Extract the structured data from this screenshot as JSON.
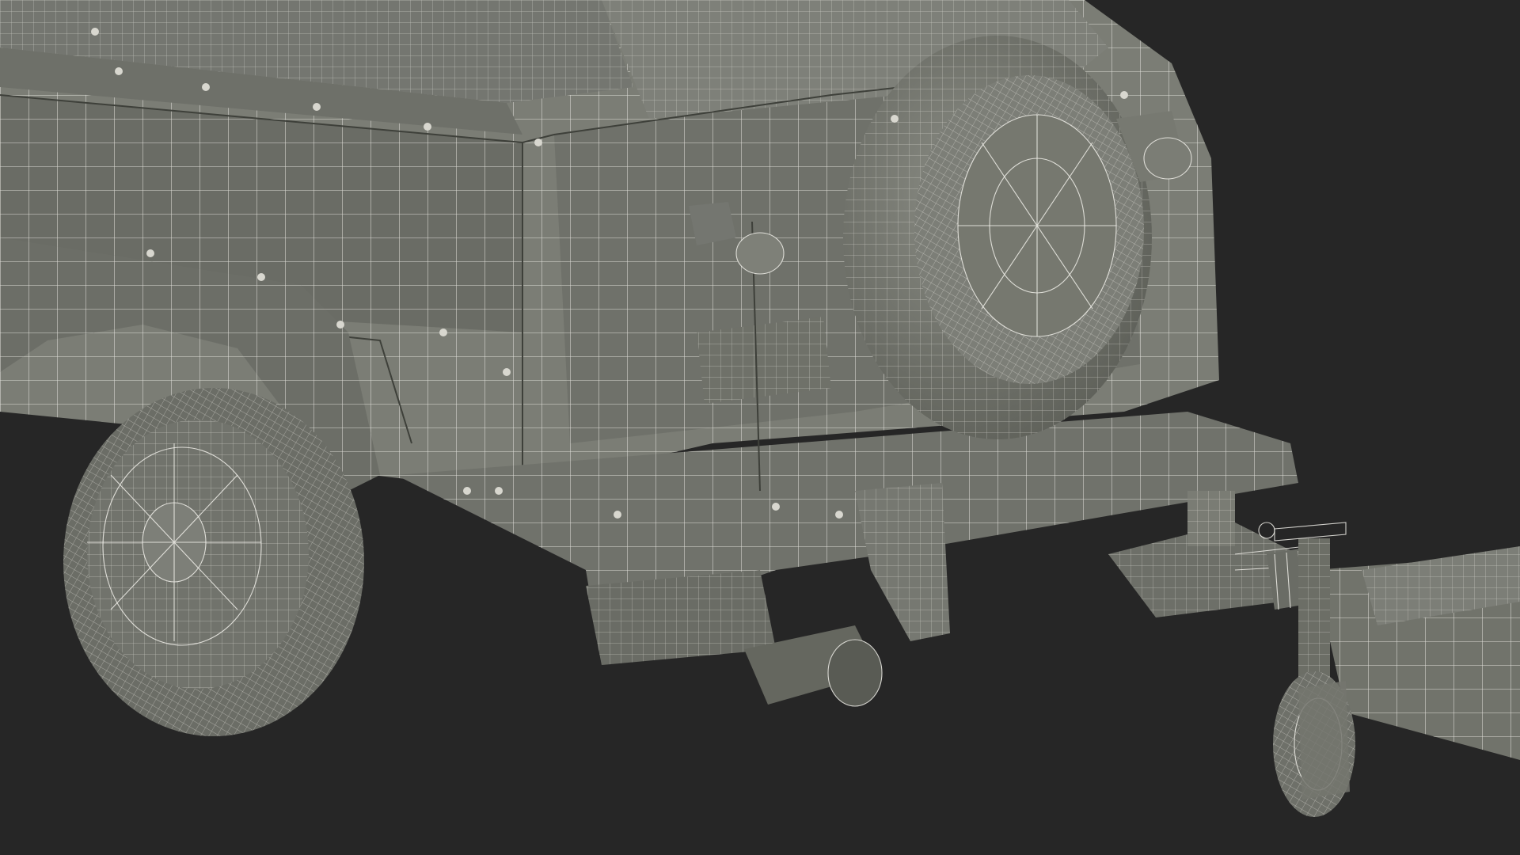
{
  "scene": {
    "subject": "vehicle-wireframe-render",
    "background_color": "#262626",
    "body_color": "#7d7f77",
    "body_shadow_color": "#5f615a",
    "wire_color": "#f1f0ea"
  }
}
